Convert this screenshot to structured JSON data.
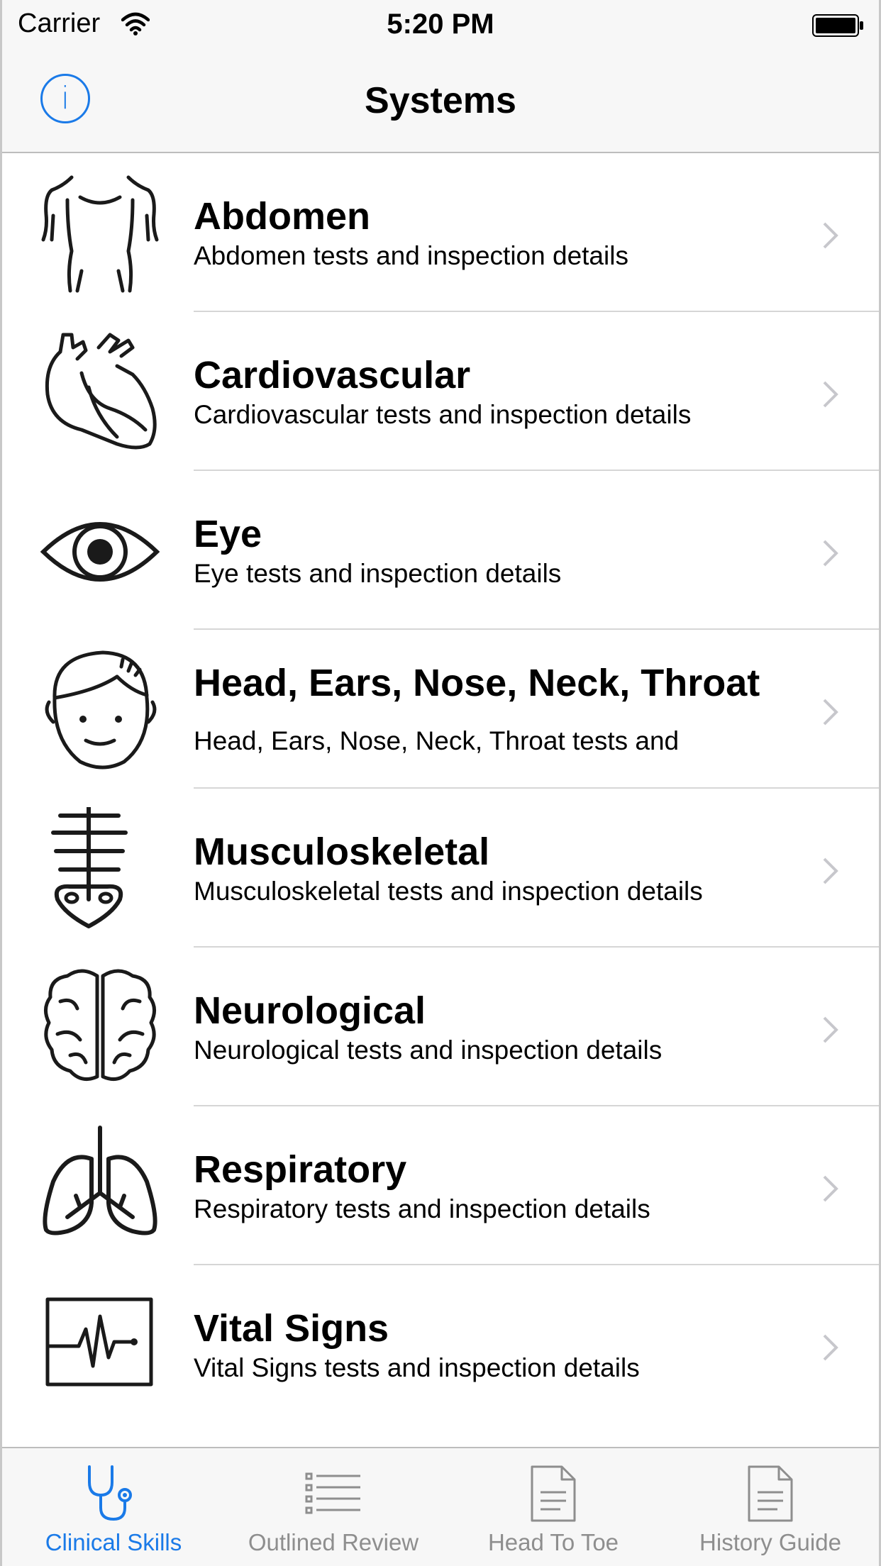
{
  "status_bar": {
    "carrier": "Carrier",
    "time": "5:20 PM",
    "wifi_icon": "wifi-icon",
    "battery_icon": "battery-full-icon"
  },
  "nav": {
    "title": "Systems",
    "info_label": "i",
    "info_icon": "info-circle-icon"
  },
  "colors": {
    "accent": "#1a7ae8",
    "inactive": "#8e8e8e",
    "bar_bg": "#f7f7f7",
    "separator": "#d6d6d6"
  },
  "systems": [
    {
      "title": "Abdomen",
      "subtitle": "Abdomen tests and inspection details",
      "icon": "torso-icon"
    },
    {
      "title": "Cardiovascular",
      "subtitle": "Cardiovascular tests and inspection details",
      "icon": "heart-icon"
    },
    {
      "title": "Eye",
      "subtitle": "Eye tests and inspection details",
      "icon": "eye-icon"
    },
    {
      "title": "Head, Ears, Nose, Neck, Throat",
      "subtitle": "Head, Ears, Nose, Neck, Throat tests and",
      "icon": "head-icon"
    },
    {
      "title": "Musculoskeletal",
      "subtitle": "Musculoskeletal tests and inspection details",
      "icon": "spine-icon"
    },
    {
      "title": "Neurological",
      "subtitle": "Neurological tests and inspection details",
      "icon": "brain-icon"
    },
    {
      "title": "Respiratory",
      "subtitle": "Respiratory tests and inspection details",
      "icon": "lungs-icon"
    },
    {
      "title": "Vital Signs",
      "subtitle": "Vital Signs tests and inspection details",
      "icon": "heart-monitor-icon"
    }
  ],
  "tabs": [
    {
      "label": "Clinical Skills",
      "icon": "stethoscope-icon",
      "selected": true
    },
    {
      "label": "Outlined Review",
      "icon": "list-icon",
      "selected": false
    },
    {
      "label": "Head To Toe",
      "icon": "document-icon",
      "selected": false
    },
    {
      "label": "History Guide",
      "icon": "document-icon",
      "selected": false
    }
  ]
}
